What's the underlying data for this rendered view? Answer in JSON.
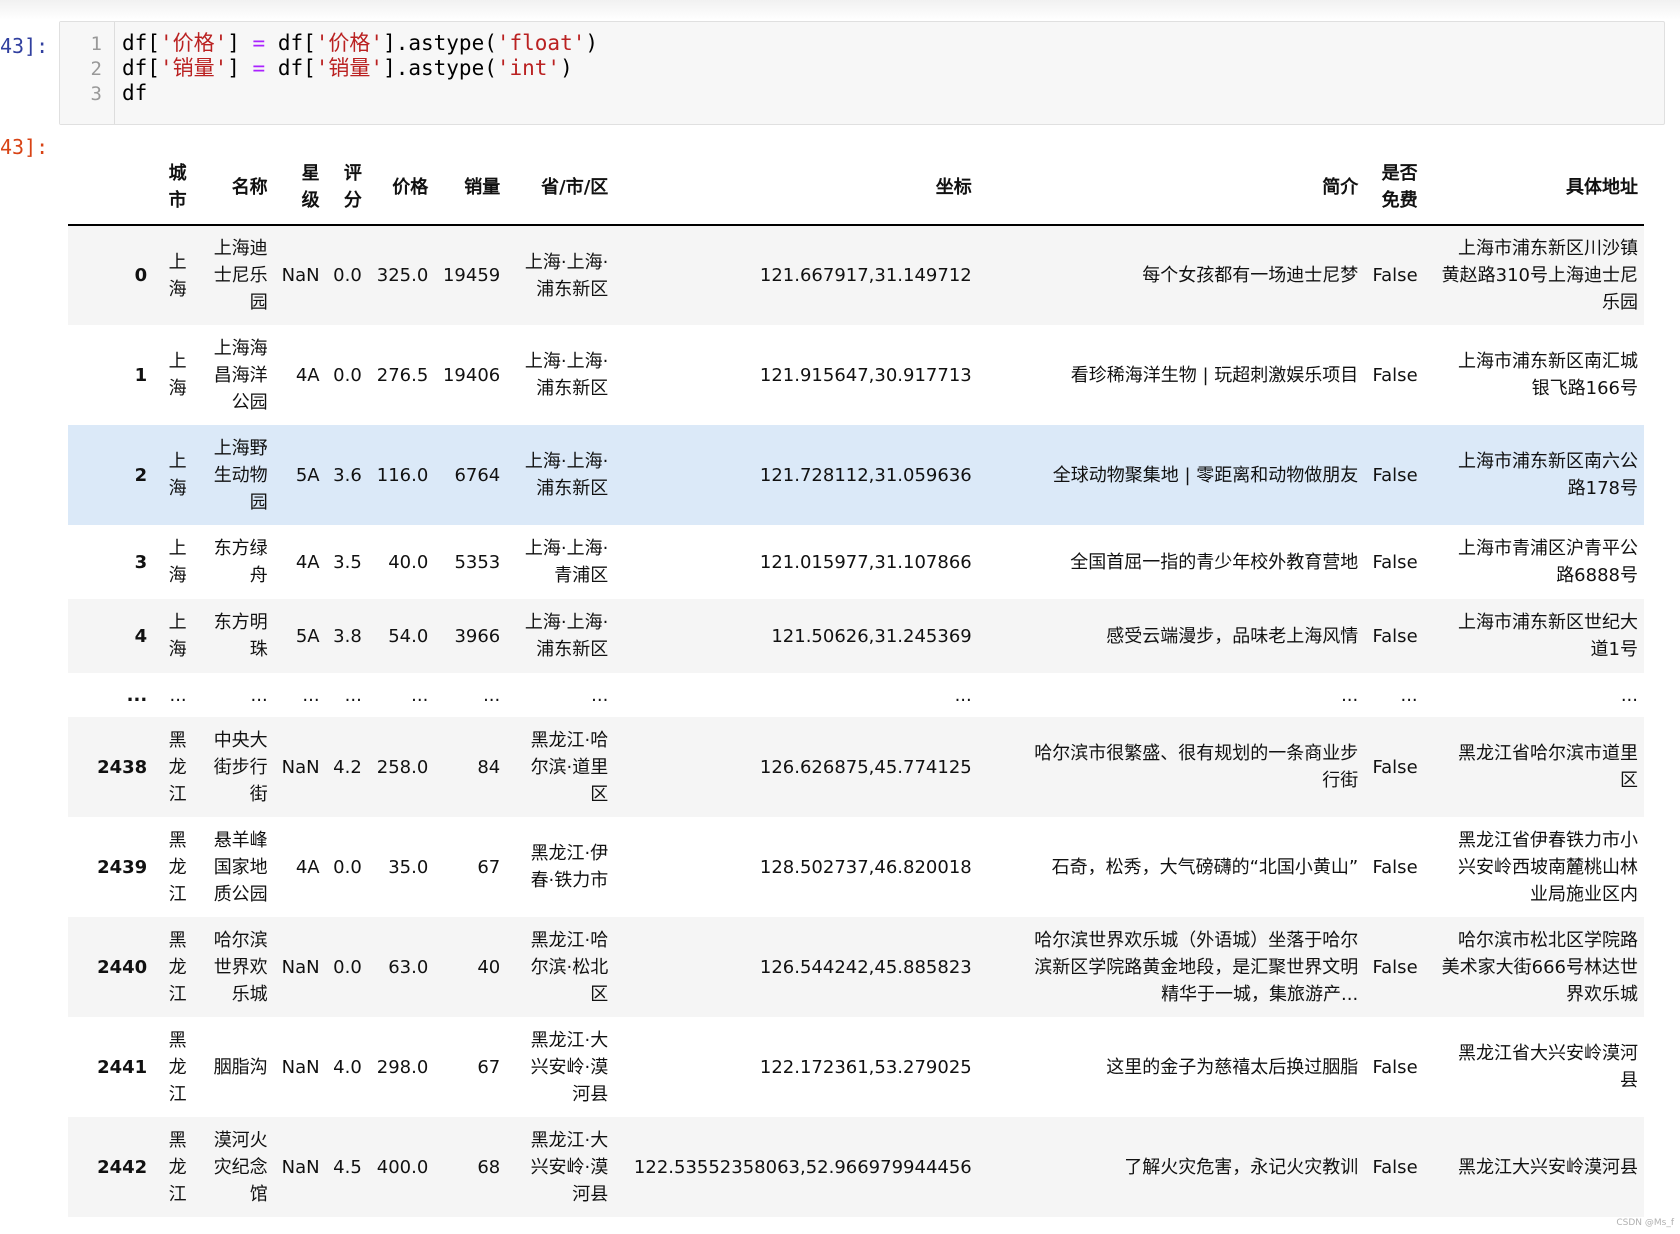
{
  "notebook": {
    "in_prompt": "43]:",
    "out_prompt": "43]:",
    "line_numbers": [
      "1",
      "2",
      "3"
    ],
    "code": {
      "line1": {
        "a": "df[",
        "s1": "'价格'",
        "b": "] ",
        "op": "=",
        "c": " df[",
        "s2": "'价格'",
        "d": "].astype(",
        "s3": "'float'",
        "e": ")"
      },
      "line2": {
        "a": "df[",
        "s1": "'销量'",
        "b": "] ",
        "op": "=",
        "c": " df[",
        "s2": "'销量'",
        "d": "].astype(",
        "s3": "'int'",
        "e": ")"
      },
      "line3": "df"
    }
  },
  "table": {
    "columns": [
      "城\n市",
      "名称",
      "星\n级",
      "评\n分",
      "价格",
      "销量",
      "省/市/区",
      "坐标",
      "简介",
      "是否\n免费",
      "具体地址"
    ],
    "rows": [
      {
        "idx": "0",
        "cells": [
          "上\n海",
          "上海迪\n士尼乐\n园",
          "NaN",
          "0.0",
          "325.0",
          "19459",
          "上海·上海·\n浦东新区",
          "121.667917,31.149712",
          "每个女孩都有一场迪士尼梦",
          "False",
          "上海市浦东新区川沙镇\n黄赵路310号上海迪士尼\n乐园"
        ]
      },
      {
        "idx": "1",
        "cells": [
          "上\n海",
          "上海海\n昌海洋\n公园",
          "4A",
          "0.0",
          "276.5",
          "19406",
          "上海·上海·\n浦东新区",
          "121.915647,30.917713",
          "看珍稀海洋生物 | 玩超刺激娱乐项目",
          "False",
          "上海市浦东新区南汇城\n银飞路166号"
        ]
      },
      {
        "idx": "2",
        "cells": [
          "上\n海",
          "上海野\n生动物\n园",
          "5A",
          "3.6",
          "116.0",
          "6764",
          "上海·上海·\n浦东新区",
          "121.728112,31.059636",
          "全球动物聚集地 | 零距离和动物做朋友",
          "False",
          "上海市浦东新区南六公\n路178号"
        ]
      },
      {
        "idx": "3",
        "cells": [
          "上\n海",
          "东方绿\n舟",
          "4A",
          "3.5",
          "40.0",
          "5353",
          "上海·上海·\n青浦区",
          "121.015977,31.107866",
          "全国首屈一指的青少年校外教育营地",
          "False",
          "上海市青浦区沪青平公\n路6888号"
        ]
      },
      {
        "idx": "4",
        "cells": [
          "上\n海",
          "东方明\n珠",
          "5A",
          "3.8",
          "54.0",
          "3966",
          "上海·上海·\n浦东新区",
          "121.50626,31.245369",
          "感受云端漫步，品味老上海风情",
          "False",
          "上海市浦东新区世纪大\n道1号"
        ]
      },
      {
        "idx": "...",
        "cells": [
          "...",
          "...",
          "...",
          "...",
          "...",
          "...",
          "...",
          "...",
          "...",
          "...",
          "..."
        ]
      },
      {
        "idx": "2438",
        "cells": [
          "黑\n龙\n江",
          "中央大\n街步行\n街",
          "NaN",
          "4.2",
          "258.0",
          "84",
          "黑龙江·哈\n尔滨·道里\n区",
          "126.626875,45.774125",
          "哈尔滨市很繁盛、很有规划的一条商业步\n行街",
          "False",
          "黑龙江省哈尔滨市道里\n区"
        ]
      },
      {
        "idx": "2439",
        "cells": [
          "黑\n龙\n江",
          "悬羊峰\n国家地\n质公园",
          "4A",
          "0.0",
          "35.0",
          "67",
          "黑龙江·伊\n春·铁力市",
          "128.502737,46.820018",
          "石奇，松秀，大气磅礴的“北国小黄山”",
          "False",
          "黑龙江省伊春铁力市小\n兴安岭西坡南麓桃山林\n业局施业区内"
        ]
      },
      {
        "idx": "2440",
        "cells": [
          "黑\n龙\n江",
          "哈尔滨\n世界欢\n乐城",
          "NaN",
          "0.0",
          "63.0",
          "40",
          "黑龙江·哈\n尔滨·松北\n区",
          "126.544242,45.885823",
          "哈尔滨世界欢乐城（外语城）坐落于哈尔\n滨新区学院路黄金地段，是汇聚世界文明\n精华于一城，集旅游产...",
          "False",
          "哈尔滨市松北区学院路\n美术家大街666号林达世\n界欢乐城"
        ]
      },
      {
        "idx": "2441",
        "cells": [
          "黑\n龙\n江",
          "胭脂沟",
          "NaN",
          "4.0",
          "298.0",
          "67",
          "黑龙江·大\n兴安岭·漠\n河县",
          "122.172361,53.279025",
          "这里的金子为慈禧太后换过胭脂",
          "False",
          "黑龙江省大兴安岭漠河\n县"
        ]
      },
      {
        "idx": "2442",
        "cells": [
          "黑\n龙\n江",
          "漠河火\n灾纪念\n馆",
          "NaN",
          "4.5",
          "400.0",
          "68",
          "黑龙江·大\n兴安岭·漠\n河县",
          "122.53552358063,52.966979944456",
          "了解火灾危害，永记火灾教训",
          "False",
          "黑龙江大兴安岭漠河县"
        ]
      }
    ]
  },
  "watermark": "CSDN @Ms_f"
}
